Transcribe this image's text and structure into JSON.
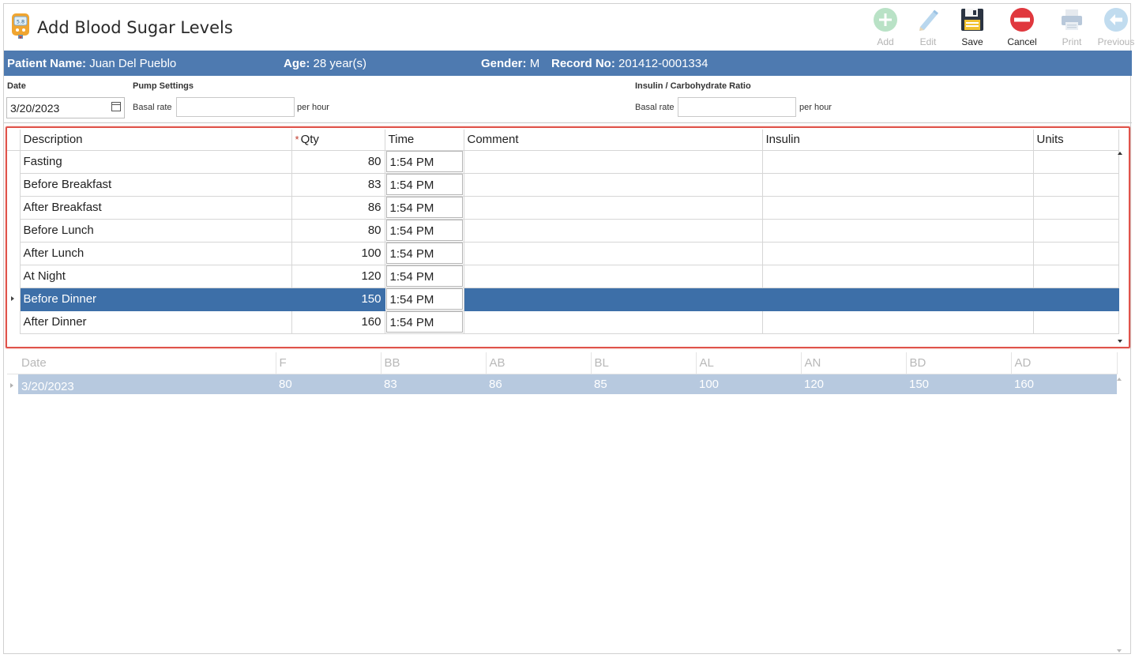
{
  "window": {
    "title": "Add Blood Sugar Levels",
    "icon": "glucose-meter-icon",
    "icon_reading": "5.8"
  },
  "toolbar": {
    "buttons": [
      {
        "label": "Add",
        "icon": "plus-circle-icon",
        "enabled": false
      },
      {
        "label": "Edit",
        "icon": "pencil-icon",
        "enabled": false
      },
      {
        "label": "Save",
        "icon": "floppy-disk-icon",
        "enabled": true
      },
      {
        "label": "Cancel",
        "icon": "minus-circle-icon",
        "enabled": true
      },
      {
        "label": "Print",
        "icon": "printer-icon",
        "enabled": false
      },
      {
        "label": "Previous",
        "icon": "arrow-left-circle-icon",
        "enabled": false
      }
    ]
  },
  "patient": {
    "name_label": "Patient Name:",
    "name": "Juan Del Pueblo",
    "age_label": "Age:",
    "age": "28 year(s)",
    "gender_label": "Gender:",
    "gender": "M",
    "record_label": "Record No:",
    "record": "201412-0001334"
  },
  "settings": {
    "date_label": "Date",
    "date_value": "3/20/2023",
    "pump_label": "Pump Settings",
    "pump_basal_label": "Basal rate",
    "pump_basal_value": "",
    "pump_unit": "per hour",
    "ratio_label": "Insulin / Carbohydrate Ratio",
    "ratio_basal_label": "Basal rate",
    "ratio_basal_value": "",
    "ratio_unit": "per hour"
  },
  "grid": {
    "columns": [
      "Description",
      "Qty",
      "Time",
      "Comment",
      "Insulin",
      "Units"
    ],
    "required_marker": "*",
    "rows": [
      {
        "description": "Fasting",
        "qty": "80",
        "time": "1:54 PM",
        "comment": "",
        "insulin": "",
        "units": ""
      },
      {
        "description": "Before Breakfast",
        "qty": "83",
        "time": "1:54 PM",
        "comment": "",
        "insulin": "",
        "units": ""
      },
      {
        "description": "After Breakfast",
        "qty": "86",
        "time": "1:54 PM",
        "comment": "",
        "insulin": "",
        "units": ""
      },
      {
        "description": "Before Lunch",
        "qty": "80",
        "time": "1:54 PM",
        "comment": "",
        "insulin": "",
        "units": ""
      },
      {
        "description": "After Lunch",
        "qty": "100",
        "time": "1:54 PM",
        "comment": "",
        "insulin": "",
        "units": ""
      },
      {
        "description": "At Night",
        "qty": "120",
        "time": "1:54 PM",
        "comment": "",
        "insulin": "",
        "units": ""
      },
      {
        "description": "Before Dinner",
        "qty": "150",
        "time": "1:54 PM",
        "comment": "",
        "insulin": "",
        "units": "",
        "selected": true
      },
      {
        "description": "After Dinner",
        "qty": "160",
        "time": "1:54 PM",
        "comment": "",
        "insulin": "",
        "units": ""
      }
    ]
  },
  "summary": {
    "columns": [
      "Date",
      "F",
      "BB",
      "AB",
      "BL",
      "AL",
      "AN",
      "BD",
      "AD"
    ],
    "rows": [
      {
        "date": "3/20/2023",
        "f": "80",
        "bb": "83",
        "ab": "86",
        "bl": "85",
        "al": "100",
        "an": "120",
        "bd": "150",
        "ad": "160"
      }
    ]
  },
  "colors": {
    "accent": "#4e7ab0",
    "selected_row": "#3d6fa8",
    "highlight_border": "#e0534a",
    "summary_row": "#b7c9df"
  }
}
